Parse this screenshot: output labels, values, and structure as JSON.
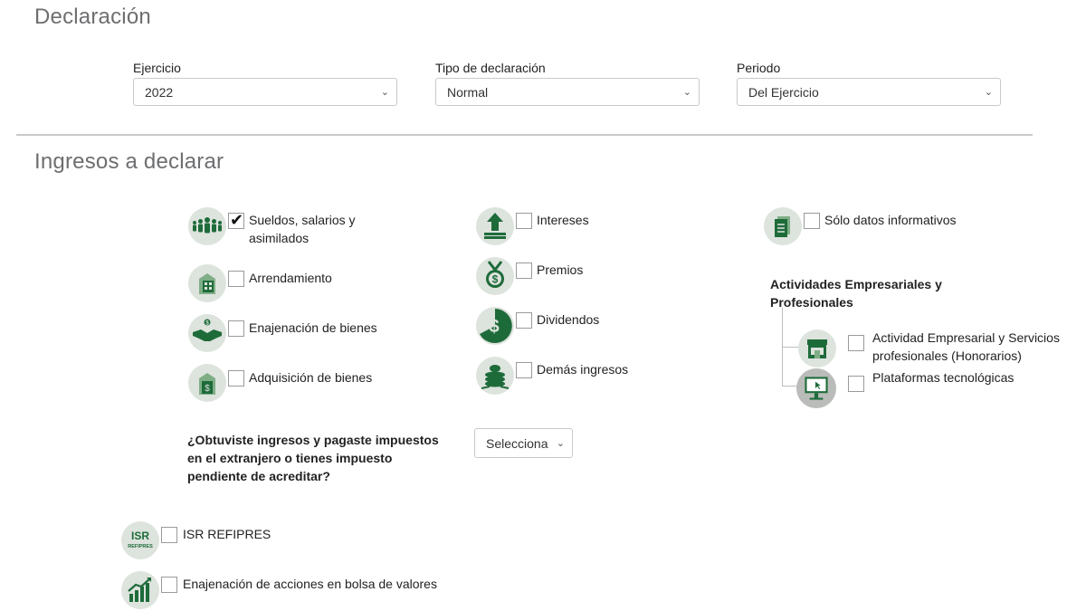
{
  "declaracion": {
    "title": "Declaración",
    "fields": [
      {
        "label": "Ejercicio",
        "value": "2022"
      },
      {
        "label": "Tipo de declaración",
        "value": "Normal"
      },
      {
        "label": "Periodo",
        "value": "Del Ejercicio"
      }
    ]
  },
  "ingresos": {
    "title": "Ingresos a declarar",
    "col1": [
      {
        "label": "Sueldos, salarios y",
        "label2": "asimilados",
        "checked": true,
        "checkmark": "✔",
        "icon": "people-icon"
      },
      {
        "label": "Arrendamiento",
        "checked": false,
        "icon": "building-icon"
      },
      {
        "label": "Enajenación de bienes",
        "checked": false,
        "icon": "handshake-money-icon"
      },
      {
        "label": "Adquisición de bienes",
        "checked": false,
        "icon": "house-money-icon"
      }
    ],
    "col2": [
      {
        "label": "Intereses",
        "checked": false,
        "icon": "money-arrow-up-icon"
      },
      {
        "label": "Premios",
        "checked": false,
        "icon": "medal-dollar-icon"
      },
      {
        "label": "Dividendos",
        "checked": false,
        "icon": "dollar-pie-icon"
      },
      {
        "label": "Demás ingresos",
        "checked": false,
        "icon": "coins-icon"
      }
    ],
    "col3": {
      "solo_datos": {
        "label": "Sólo datos informativos",
        "checked": false,
        "icon": "document-icon"
      },
      "actividades_title_1": "Actividades Empresariales y",
      "actividades_title_2": "Profesionales",
      "sub_items": [
        {
          "label": "Actividad Empresarial y Servicios",
          "label2": "profesionales (Honorarios)",
          "checked": false,
          "icon": "storefront-icon"
        },
        {
          "label": "Plataformas tecnológicas",
          "checked": false,
          "icon": "monitor-cursor-icon"
        }
      ]
    },
    "extranjero_question": {
      "line1": "¿Obtuviste ingresos y pagaste impuestos",
      "line2": "en el extranjero o tienes impuesto",
      "line3": "pendiente de acreditar?",
      "select_value": "Selecciona"
    },
    "bottom": [
      {
        "label": "ISR REFIPRES",
        "icon": "isr-refipres-icon",
        "icon_text": "ISR",
        "icon_subtext": "REFIPRES",
        "checked": false
      },
      {
        "label": "Enajenación de acciones en bolsa de valores",
        "icon": "growth-chart-icon",
        "checked": false
      }
    ]
  },
  "colors": {
    "icon_green": "#1e6b3a",
    "icon_bg": "#dde3dd",
    "title_gray": "#6d6e70"
  }
}
